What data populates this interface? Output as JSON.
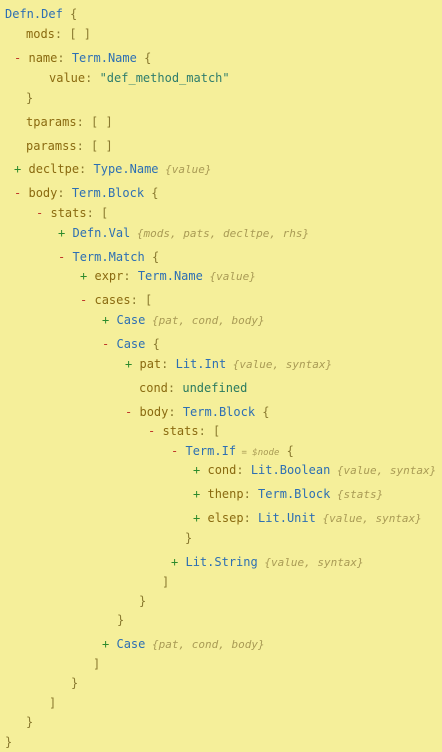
{
  "tree": [
    {
      "id": "defn-def",
      "parts": [
        {
          "t": "Defn.Def",
          "c": "type"
        },
        {
          "t": "  {",
          "c": "punct"
        }
      ]
    },
    {
      "id": "mods",
      "parts": [
        {
          "t": "mods",
          "c": "key"
        },
        {
          "t": ": [ ]",
          "c": "punct"
        }
      ]
    },
    {
      "id": "name",
      "toggle": "-",
      "parts": [
        {
          "t": "name",
          "c": "key"
        },
        {
          "t": ": ",
          "c": "punct"
        },
        {
          "t": "Term.Name",
          "c": "type"
        },
        {
          "t": "  {",
          "c": "punct"
        }
      ]
    },
    {
      "id": "name-value",
      "parts": [
        {
          "t": "value",
          "c": "key"
        },
        {
          "t": ": ",
          "c": "punct"
        },
        {
          "t": "\"def_method_match\"",
          "c": "str"
        }
      ]
    },
    {
      "id": "name-close",
      "parts": [
        {
          "t": "}",
          "c": "punct"
        }
      ]
    },
    {
      "id": "tparams",
      "parts": [
        {
          "t": "tparams",
          "c": "key"
        },
        {
          "t": ": [ ]",
          "c": "punct"
        }
      ]
    },
    {
      "id": "paramss",
      "parts": [
        {
          "t": "paramss",
          "c": "key"
        },
        {
          "t": ": [ ]",
          "c": "punct"
        }
      ]
    },
    {
      "id": "decltpe",
      "toggle": "+",
      "parts": [
        {
          "t": "decltpe",
          "c": "key"
        },
        {
          "t": ": ",
          "c": "punct"
        },
        {
          "t": "Type.Name",
          "c": "type"
        },
        {
          "t": " {value}",
          "c": "hint"
        }
      ]
    },
    {
      "id": "body",
      "toggle": "-",
      "parts": [
        {
          "t": "body",
          "c": "key"
        },
        {
          "t": ": ",
          "c": "punct"
        },
        {
          "t": "Term.Block",
          "c": "type"
        },
        {
          "t": "  {",
          "c": "punct"
        }
      ]
    },
    {
      "id": "body-stats",
      "toggle": "-",
      "parts": [
        {
          "t": "stats",
          "c": "key"
        },
        {
          "t": ":  [",
          "c": "punct"
        }
      ]
    },
    {
      "id": "defn-val",
      "toggle": "+",
      "parts": [
        {
          "t": "Defn.Val",
          "c": "type"
        },
        {
          "t": " {mods, pats, decltpe, rhs}",
          "c": "hint"
        }
      ]
    },
    {
      "id": "term-match",
      "toggle": "-",
      "parts": [
        {
          "t": "Term.Match",
          "c": "type"
        },
        {
          "t": "  {",
          "c": "punct"
        }
      ]
    },
    {
      "id": "expr",
      "toggle": "+",
      "parts": [
        {
          "t": "expr",
          "c": "key"
        },
        {
          "t": ": ",
          "c": "punct"
        },
        {
          "t": "Term.Name",
          "c": "type"
        },
        {
          "t": " {value}",
          "c": "hint"
        }
      ]
    },
    {
      "id": "cases",
      "toggle": "-",
      "parts": [
        {
          "t": "cases",
          "c": "key"
        },
        {
          "t": ":  [",
          "c": "punct"
        }
      ]
    },
    {
      "id": "case-1",
      "toggle": "+",
      "parts": [
        {
          "t": "Case",
          "c": "type"
        },
        {
          "t": " {pat, cond, body}",
          "c": "hint"
        }
      ]
    },
    {
      "id": "case-2",
      "toggle": "-",
      "parts": [
        {
          "t": "Case",
          "c": "type"
        },
        {
          "t": "  {",
          "c": "punct"
        }
      ]
    },
    {
      "id": "pat",
      "toggle": "+",
      "parts": [
        {
          "t": "pat",
          "c": "key"
        },
        {
          "t": ": ",
          "c": "punct"
        },
        {
          "t": "Lit.Int",
          "c": "type"
        },
        {
          "t": " {value, syntax}",
          "c": "hint"
        }
      ]
    },
    {
      "id": "cond",
      "parts": [
        {
          "t": "cond",
          "c": "key"
        },
        {
          "t": ": ",
          "c": "punct"
        },
        {
          "t": "undefined",
          "c": "undef"
        }
      ]
    },
    {
      "id": "case-body",
      "toggle": "-",
      "parts": [
        {
          "t": "body",
          "c": "key"
        },
        {
          "t": ": ",
          "c": "punct"
        },
        {
          "t": "Term.Block",
          "c": "type"
        },
        {
          "t": "  {",
          "c": "punct"
        }
      ]
    },
    {
      "id": "case-body-stats",
      "toggle": "-",
      "parts": [
        {
          "t": "stats",
          "c": "key"
        },
        {
          "t": ":  [",
          "c": "punct"
        }
      ]
    },
    {
      "id": "term-if",
      "toggle": "-",
      "parts": [
        {
          "t": "Term.If",
          "c": "type"
        },
        {
          "t": " = $node",
          "c": "sub"
        },
        {
          "t": " {",
          "c": "punct"
        }
      ]
    },
    {
      "id": "if-cond",
      "toggle": "+",
      "parts": [
        {
          "t": "cond",
          "c": "key"
        },
        {
          "t": ": ",
          "c": "punct"
        },
        {
          "t": "Lit.Boolean",
          "c": "type"
        },
        {
          "t": " {value, syntax}",
          "c": "hint"
        }
      ]
    },
    {
      "id": "thenp",
      "toggle": "+",
      "parts": [
        {
          "t": "thenp",
          "c": "key"
        },
        {
          "t": ": ",
          "c": "punct"
        },
        {
          "t": "Term.Block",
          "c": "type"
        },
        {
          "t": " {stats}",
          "c": "hint"
        }
      ]
    },
    {
      "id": "elsep",
      "toggle": "+",
      "parts": [
        {
          "t": "elsep",
          "c": "key"
        },
        {
          "t": ": ",
          "c": "punct"
        },
        {
          "t": "Lit.Unit",
          "c": "type"
        },
        {
          "t": " {value, syntax}",
          "c": "hint"
        }
      ]
    },
    {
      "id": "term-if-close",
      "parts": [
        {
          "t": "}",
          "c": "punct"
        }
      ]
    },
    {
      "id": "lit-string",
      "toggle": "+",
      "parts": [
        {
          "t": "Lit.String",
          "c": "type"
        },
        {
          "t": " {value, syntax}",
          "c": "hint"
        }
      ]
    },
    {
      "id": "case-body-stats-close",
      "parts": [
        {
          "t": "]",
          "c": "punct"
        }
      ]
    },
    {
      "id": "case-body-close",
      "parts": [
        {
          "t": "}",
          "c": "punct"
        }
      ]
    },
    {
      "id": "case-2-close",
      "parts": [
        {
          "t": "}",
          "c": "punct"
        }
      ]
    },
    {
      "id": "case-3",
      "toggle": "+",
      "parts": [
        {
          "t": "Case",
          "c": "type"
        },
        {
          "t": " {pat, cond, body}",
          "c": "hint"
        }
      ]
    },
    {
      "id": "cases-close",
      "parts": [
        {
          "t": "]",
          "c": "punct"
        }
      ]
    },
    {
      "id": "term-match-close",
      "parts": [
        {
          "t": "}",
          "c": "punct"
        }
      ]
    },
    {
      "id": "body-stats-close",
      "parts": [
        {
          "t": "]",
          "c": "punct"
        }
      ]
    },
    {
      "id": "body-close",
      "parts": [
        {
          "t": "}",
          "c": "punct"
        }
      ]
    },
    {
      "id": "defn-def-close",
      "parts": [
        {
          "t": "}",
          "c": "punct"
        }
      ]
    }
  ]
}
